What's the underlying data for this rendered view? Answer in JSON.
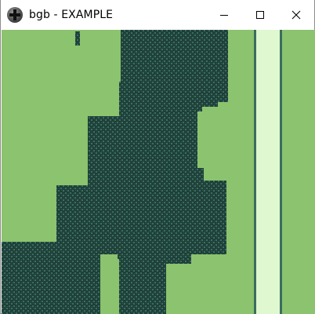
{
  "window": {
    "title": "bgb - EXAMPLE",
    "app_icon": "dpad-icon",
    "controls": [
      "minimize-icon",
      "maximize-icon",
      "close-icon"
    ]
  },
  "game": {
    "palette": {
      "grass": "#8cc36e",
      "tree_dark": "#20403a",
      "tree_light": "#3a6e60",
      "path": "#e0f8d0",
      "path_edge": "#3a6e60"
    }
  }
}
